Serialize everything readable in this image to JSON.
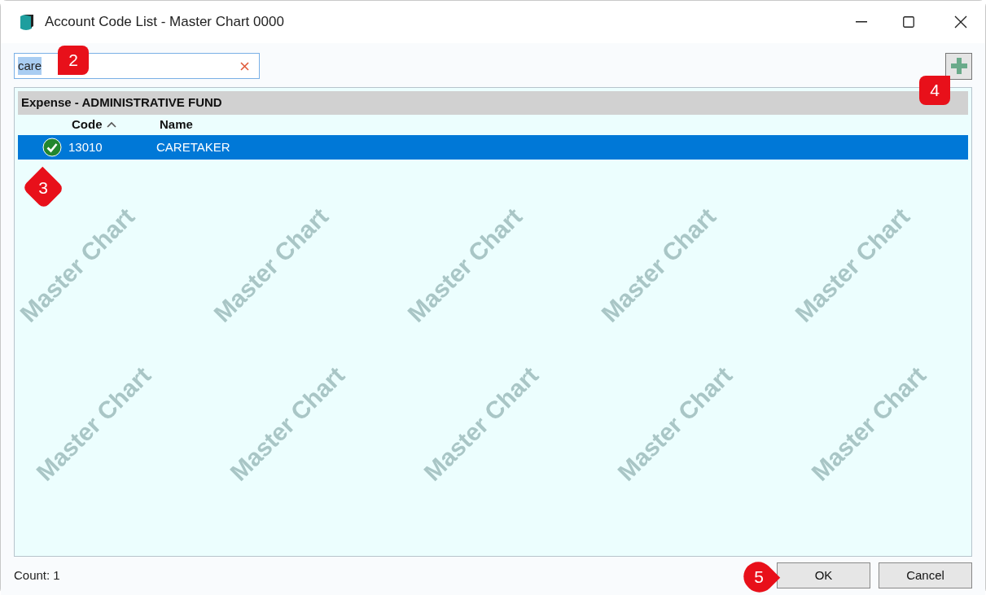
{
  "window": {
    "title": "Account Code List - Master Chart 0000"
  },
  "search": {
    "value": "care",
    "selected_text": true
  },
  "group": {
    "title": "Expense - ADMINISTRATIVE FUND"
  },
  "columns": [
    {
      "label": "Code",
      "sorted": true
    },
    {
      "label": "Name",
      "sorted": false
    }
  ],
  "rows": [
    {
      "verified": true,
      "code": "13010",
      "name": "CARETAKER",
      "selected": true
    }
  ],
  "watermarks": [
    "Master Chart",
    "Master Chart",
    "Master Chart",
    "Master Chart",
    "Master Chart",
    "Master Chart",
    "Master Chart",
    "Master Chart",
    "Master Chart",
    "Master Chart"
  ],
  "count": "Count: 1",
  "buttons": [
    {
      "label": "OK"
    },
    {
      "label": "Cancel"
    }
  ],
  "callouts": [
    {
      "label": "2"
    },
    {
      "label": "3"
    },
    {
      "label": "4"
    },
    {
      "label": "5"
    }
  ]
}
